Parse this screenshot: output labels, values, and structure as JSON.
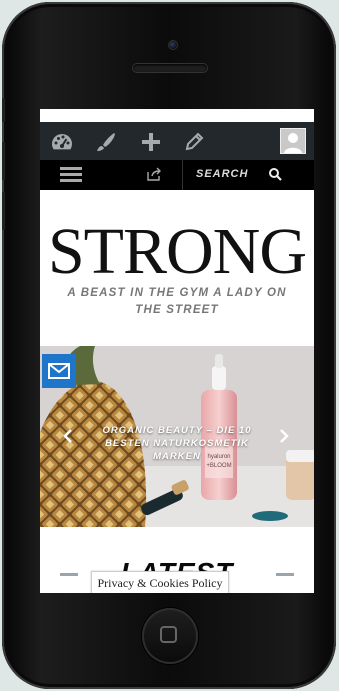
{
  "admin_bar": {
    "icons": [
      "dashboard-icon",
      "customize-brush-icon",
      "new-plus-icon",
      "edit-pencil-icon"
    ],
    "avatar": "user-avatar"
  },
  "nav": {
    "menu_icon": "hamburger-icon",
    "share_icon": "share-icon",
    "search_label": "SEARCH",
    "search_icon": "search-icon"
  },
  "site": {
    "logo": "STRONG",
    "tagline": "A BEAST IN THE GYM A LADY ON THE STREET"
  },
  "slider": {
    "slide_title": "ORGANIC BEAUTY – DIE 10 BESTEN NATURKOSMETIK MARKEN",
    "bottle_label": "hyaluron +BLOOM",
    "prev_icon": "chevron-left-icon",
    "next_icon": "chevron-right-icon"
  },
  "float": {
    "email_icon": "email-icon",
    "color": "#1e75c9"
  },
  "latest": {
    "title": "LATEST POSTS"
  },
  "cookies": {
    "label": "Privacy & Cookies Policy"
  }
}
